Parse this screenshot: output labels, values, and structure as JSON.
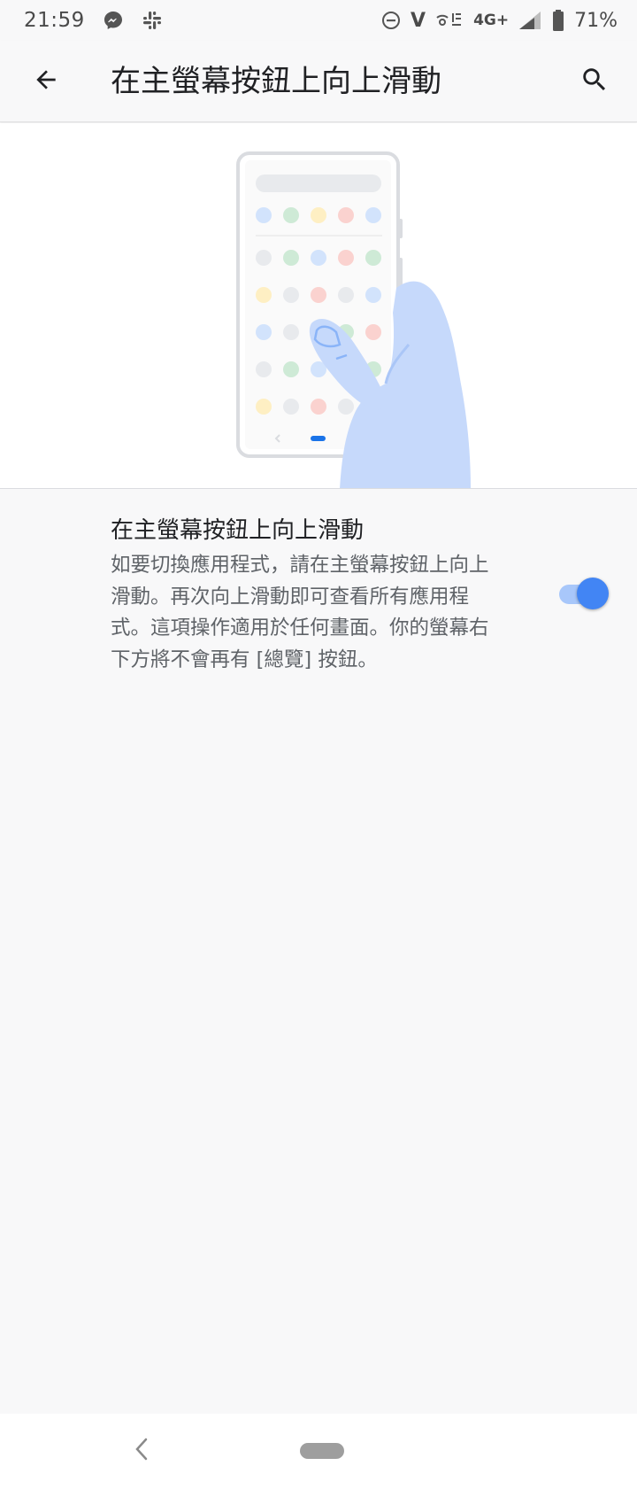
{
  "status_bar": {
    "time": "21:59",
    "network": "4G+",
    "volte": "V",
    "battery": "71%",
    "icons": [
      "messenger-icon",
      "slack-icon",
      "do-not-disturb-icon",
      "volte-icon",
      "wifi-calling-icon",
      "signal-icon",
      "battery-icon"
    ]
  },
  "app_bar": {
    "title": "在主螢幕按鈕上向上滑動",
    "back_icon": "arrow-back-icon",
    "search_icon": "search-icon"
  },
  "setting": {
    "title": "在主螢幕按鈕上向上滑動",
    "summary": "如要切換應用程式，請在主螢幕按鈕上向上滑動。再次向上滑動即可查看所有應用程式。這項操作適用於任何畫面。你的螢幕右下方將不會再有 [總覽] 按鈕。",
    "enabled": true
  },
  "colors": {
    "accent": "#4285f4",
    "accent_track": "#a8c7fa",
    "hand": "#c6d9fb"
  },
  "nav_bar": {
    "back_icon": "nav-back-icon",
    "home_icon": "nav-home-pill"
  }
}
